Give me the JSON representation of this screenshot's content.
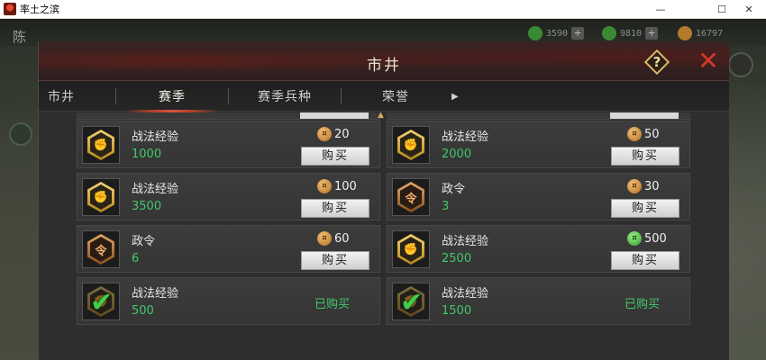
{
  "window": {
    "title": "率土之滨",
    "min_glyph": "—",
    "max_glyph": "☐",
    "close_glyph": "✕"
  },
  "hud": {
    "left_badge": "陈",
    "resources": [
      {
        "icon": "jade-icon",
        "value": "3590",
        "color": "#3a8a34"
      },
      {
        "icon": "jade-icon",
        "value": "9810",
        "color": "#3a8a34"
      },
      {
        "icon": "copper-icon",
        "value": "16797",
        "color": "#b27a2a"
      }
    ]
  },
  "panel": {
    "title": "市井",
    "help_glyph": "?",
    "close_glyph": "✕"
  },
  "tabs": [
    {
      "label": "市井",
      "active": false
    },
    {
      "label": "赛季",
      "active": true
    },
    {
      "label": "赛季兵种",
      "active": false
    },
    {
      "label": "荣誉",
      "active": false
    }
  ],
  "tab_next_glyph": "▶",
  "scroll_up_glyph": "▲",
  "buy_label": "购买",
  "bought_label": "已购买",
  "items": [
    {
      "name": "战法经验",
      "qty": "1000",
      "icon": "fist-icon",
      "currency": "copper",
      "price": "20",
      "status": "buy"
    },
    {
      "name": "战法经验",
      "qty": "2000",
      "icon": "fist-icon",
      "currency": "copper",
      "price": "50",
      "status": "buy"
    },
    {
      "name": "战法经验",
      "qty": "3500",
      "icon": "fist-icon",
      "currency": "copper",
      "price": "100",
      "status": "buy"
    },
    {
      "name": "政令",
      "qty": "3",
      "icon": "order-icon",
      "currency": "copper",
      "price": "30",
      "status": "buy"
    },
    {
      "name": "政令",
      "qty": "6",
      "icon": "order-icon",
      "currency": "copper",
      "price": "60",
      "status": "buy"
    },
    {
      "name": "战法经验",
      "qty": "2500",
      "icon": "fist-icon",
      "currency": "jade",
      "price": "500",
      "status": "buy"
    },
    {
      "name": "战法经验",
      "qty": "500",
      "icon": "fist-icon",
      "currency": "copper",
      "price": "",
      "status": "bought"
    },
    {
      "name": "战法经验",
      "qty": "1500",
      "icon": "fist-icon",
      "currency": "copper",
      "price": "",
      "status": "bought"
    }
  ],
  "icon_glyphs": {
    "fist": "✊",
    "order": "令",
    "check": "✔",
    "copper_coin": "¤",
    "jade_coin": "¤"
  }
}
